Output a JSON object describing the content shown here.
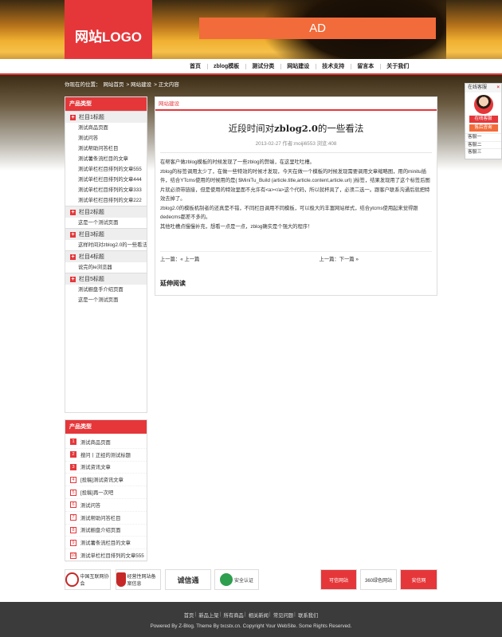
{
  "header": {
    "logo_text": "网站LOGO",
    "ad_text": "AD",
    "nav": [
      "首页",
      "zblog模板",
      "测试分类",
      "网站建设",
      "技术支持",
      "留言本",
      "关于我们"
    ]
  },
  "breadcrumb": [
    "你现在的位置：",
    "网站首页",
    "> 网站建设",
    "> 正文内容"
  ],
  "sidebar_categories": {
    "title": "产品类型",
    "groups": [
      {
        "label": "栏目1标题",
        "items": [
          "测试商品页面",
          "测试问答",
          "测试帮助问答栏目",
          "测试薯条流栏目的文章",
          "测试单栏栏目排列的文章555",
          "测试单栏栏目排列的文章444",
          "测试单栏栏目排列的文章333",
          "测试单栏栏目排列的文章222"
        ]
      },
      {
        "label": "栏目2标题",
        "items": [
          "这是一个测试页面"
        ]
      },
      {
        "label": "栏目3标题",
        "items": [
          "这样时间对zblog2.0的一些看法"
        ]
      },
      {
        "label": "栏目4标题",
        "items": [
          "说完的ie浏览器"
        ]
      },
      {
        "label": "栏目5标题",
        "items": [
          "测试橱盘手介绍页面",
          "这是一个测试页面"
        ]
      }
    ]
  },
  "sidebar_rank": {
    "title": "产品类型",
    "items": [
      {
        "num": "1",
        "text": "测试商品页面"
      },
      {
        "num": "2",
        "text": "搜问丨正经的测试标题"
      },
      {
        "num": "3",
        "text": "测试资讯文章"
      },
      {
        "num": "4",
        "text": "[投稿]测试资讯文章"
      },
      {
        "num": "5",
        "text": "[投稿]再一次吧"
      },
      {
        "num": "6",
        "text": "测试问答"
      },
      {
        "num": "7",
        "text": "测试帮助问答栏目"
      },
      {
        "num": "8",
        "text": "测试橱盘介绍页面"
      },
      {
        "num": "9",
        "text": "测试薯条流栏目的文章"
      },
      {
        "num": "10",
        "text": "测试单栏栏目排列的文章555"
      }
    ]
  },
  "article": {
    "section": "网站建设",
    "title_prefix": "近段时间对",
    "title_bold": "zblog2.0",
    "title_suffix": "的一些看法",
    "meta": "2013-02-27 作者:moiji6553 浏览:408",
    "paragraphs": [
      "在帮客户做zblog模板的时候发现了一些zblog的弊端，在这里吐吐槽。",
      "zblog的标签调用太少了，在做一些特效的时候才发现，今天在做一个模板的时候发现需要调用文章缩略图，用的minitu插件，结合YTcms使用的时候用的是{ $MiniTu_Build (article.title,article.content,article.url) }标签，结果发现用了这个标签后图片就必须带链接，但是使用的特效里面不允许有<a></a>这个代码，所以就杯具了，必须二选一。跟客户联系沟通后就把特效去掉了。",
      "zblog2.0的模板机制者的还真是不错，不同栏目调用不同模板，可以极大的丰富网站样式，结合ytcms使用起来觉得跟dedecms都差不多的。",
      "其他吐槽点慢慢补充，想看一点是一点，zblog确实是个强大的程序！"
    ],
    "prev": "上一篇：« 上一篇",
    "next": "上一篇：下一篇 »",
    "extend_title": "延伸阅读"
  },
  "customer_service": {
    "top_label": "在线客服",
    "close": "×",
    "online_btn": "在线客服",
    "after_sale_btn": "售后咨询",
    "items": [
      "客服一",
      "客服二",
      "客服三"
    ]
  },
  "partners": [
    {
      "text": "中国互联网协会"
    },
    {
      "text": "经营性网站备案信息"
    },
    {
      "text": "诚信通"
    },
    {
      "text": "安全认证"
    },
    {
      "text": "可信网站"
    },
    {
      "text": "360绿色网站"
    },
    {
      "text": "安信网"
    }
  ],
  "footer": {
    "links": [
      "首页",
      "新品上架",
      "所有商品",
      "相关新闻",
      "常见问题",
      "联系我们"
    ],
    "copyright": "Powered By Z-Blog. Theme By txcstx.cn. Copyright Your WebSite. Some Rights Reserved."
  },
  "colors": {
    "accent": "#e5373a",
    "ad": "#f26b3a",
    "footer_bg": "#3b3b3b"
  }
}
